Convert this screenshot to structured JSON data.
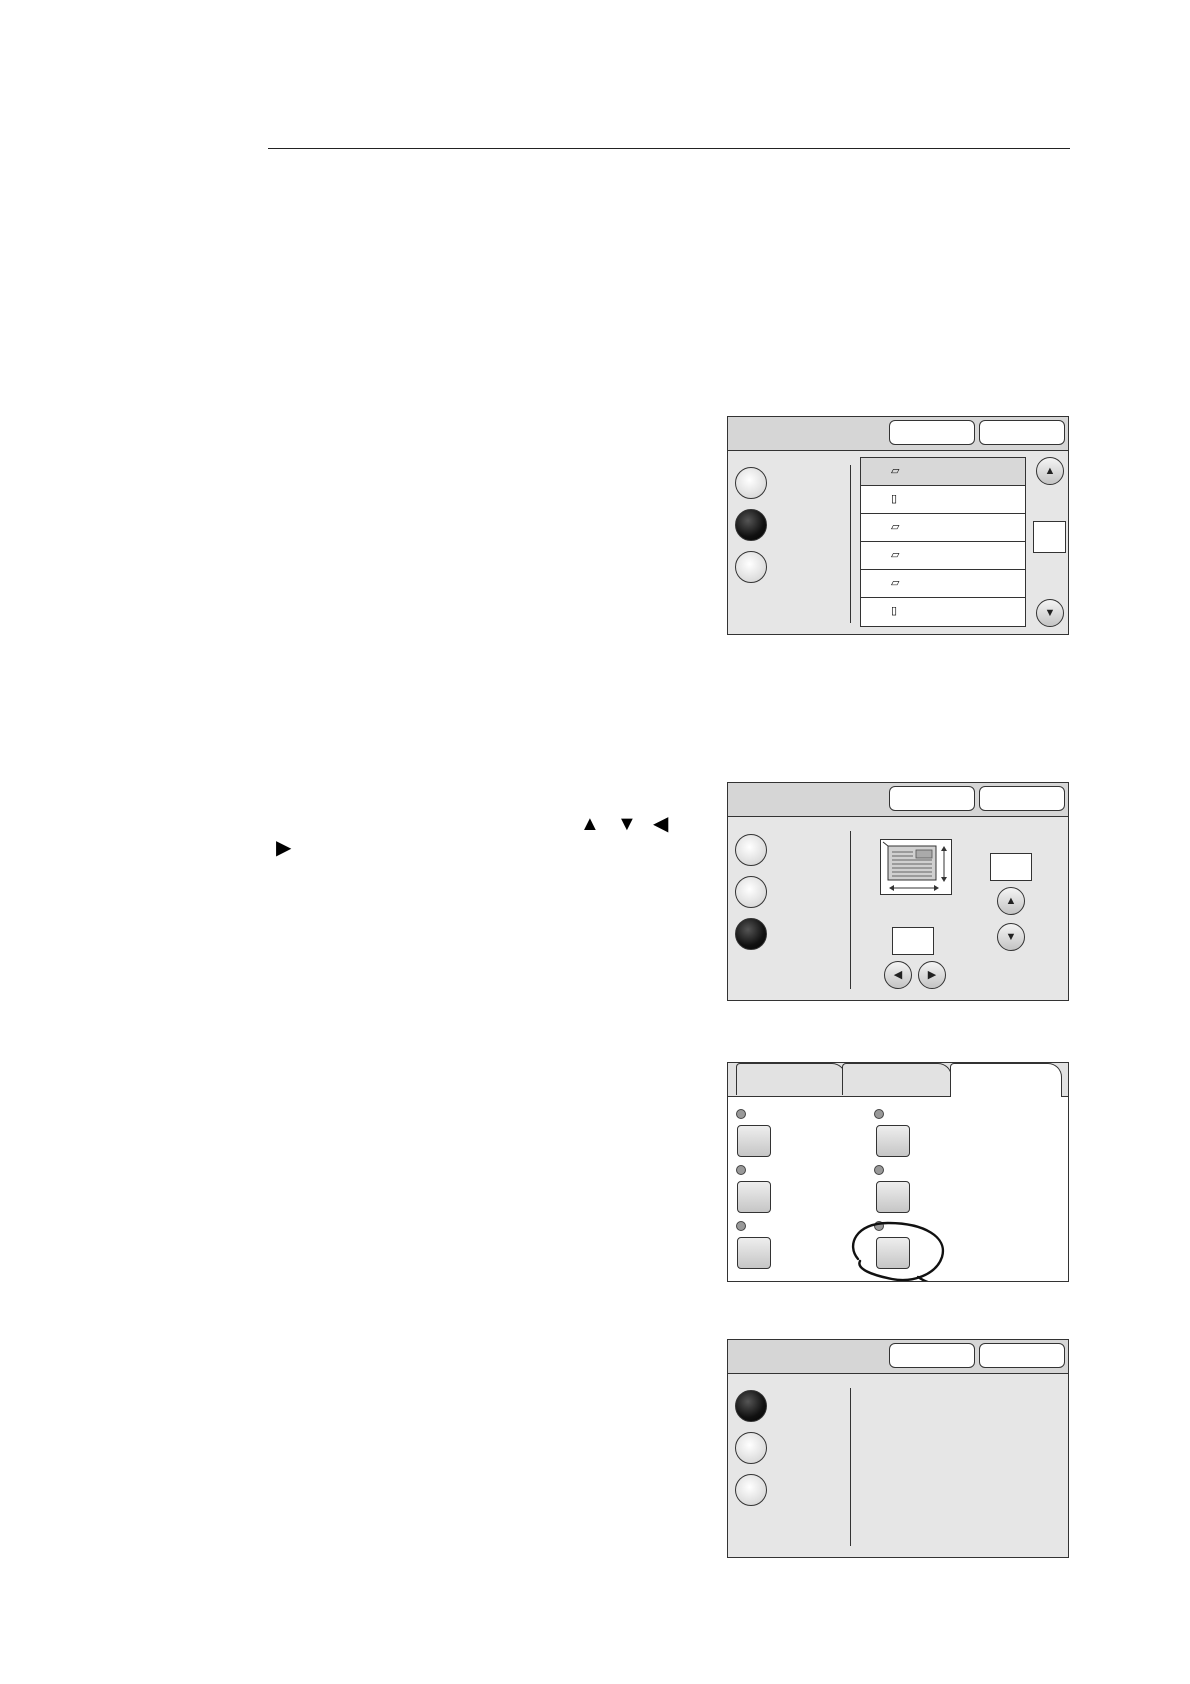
{
  "page": {
    "arrow_glyphs": [
      "▲",
      "▼",
      "◀",
      "▶"
    ]
  },
  "icons": {
    "doc_landscape": "▱",
    "doc_portrait": "▯",
    "arrow_up": "▲",
    "arrow_down": "▼",
    "arrow_left": "◀",
    "arrow_right": "▶"
  },
  "colors": {
    "panel_bg": "#e6e6e6",
    "panel_bar": "#d6d6d6",
    "outline": "#333333",
    "selected_radio": "#111111",
    "highlight_row": "#d8d8d8"
  },
  "panel1": {
    "selected_radio_index": 1,
    "list_highlight_index": 0,
    "list_icons": [
      "landscape",
      "portrait",
      "landscape",
      "landscape",
      "landscape",
      "portrait"
    ]
  },
  "panel2": {
    "selected_radio_index": 2
  },
  "panel3": {
    "active_tab_index": 2,
    "circled_button": "feature-button-6"
  },
  "panel4": {
    "selected_radio_index": 0
  }
}
